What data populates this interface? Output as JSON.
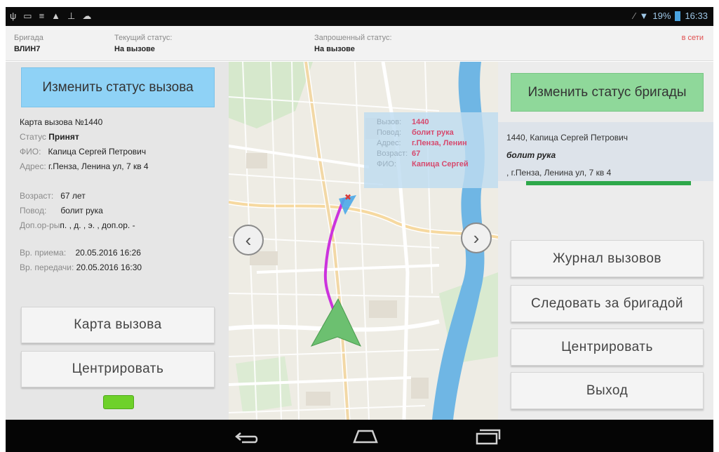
{
  "status_bar": {
    "left_icons": [
      "usb-icon",
      "image-icon",
      "menu-icon",
      "warning-icon",
      "download-icon",
      "cloud-icon"
    ],
    "battery": "19%",
    "time": "16:33"
  },
  "header": {
    "brigade_label": "Бригада",
    "brigade_value": "ВЛИН7",
    "current_status_label": "Текущий статус:",
    "current_status_value": "На вызове",
    "requested_status_label": "Запрошенный статус:",
    "requested_status_value": "На вызове",
    "online": "в сети"
  },
  "left": {
    "change_call_status": "Изменить статус вызова",
    "card_title": "Карта вызова №1440",
    "status_label": "Статус",
    "status_value": "Принят",
    "fio_label": "ФИО:",
    "fio_value": "Капица Сергей Петрович",
    "address_label": "Адрес:",
    "address_value": "г.Пенза, Ленина ул, 7 кв 4",
    "age_label": "Возраст:",
    "age_value": "67 лет",
    "reason_label": "Повод:",
    "reason_value": "болит рука",
    "extra_label": "Доп.ор-ры",
    "extra_value": "п. , д. , э. , доп.ор. -",
    "recv_label": "Вр. приема:",
    "recv_value": "20.05.2016 16:26",
    "transfer_label": "Вр. передачи:",
    "transfer_value": "20.05.2016 16:30",
    "call_card_button": "Карта вызова",
    "center_button": "Центрировать",
    "indicator_color": "#6ed12a"
  },
  "map": {
    "popup": {
      "call_label": "Вызов:",
      "call_value": "1440",
      "reason_label": "Повод:",
      "reason_value": "болит рука",
      "address_label": "Адрес:",
      "address_value": "г.Пенза, Ленин",
      "age_label": "Возраст:",
      "age_value": "67",
      "fio_label": "ФИО:",
      "fio_value": "Капица Сергей"
    },
    "prev_glyph": "‹",
    "next_glyph": "›",
    "route_color": "#cc33dd",
    "vehicle_color": "#5cb85c"
  },
  "right": {
    "change_brigade_status": "Изменить статус бригады",
    "card_line1": "1440, Капица Сергей Петрович",
    "card_line2": "болит рука",
    "card_line3": ", г.Пенза, Ленина ул, 7 кв 4",
    "journal_button": "Журнал вызовов",
    "follow_button": "Следовать за бригадой",
    "center_button": "Центрировать",
    "exit_button": "Выход"
  },
  "navbar": {
    "icons": [
      "back-icon",
      "home-icon",
      "recents-icon"
    ]
  }
}
